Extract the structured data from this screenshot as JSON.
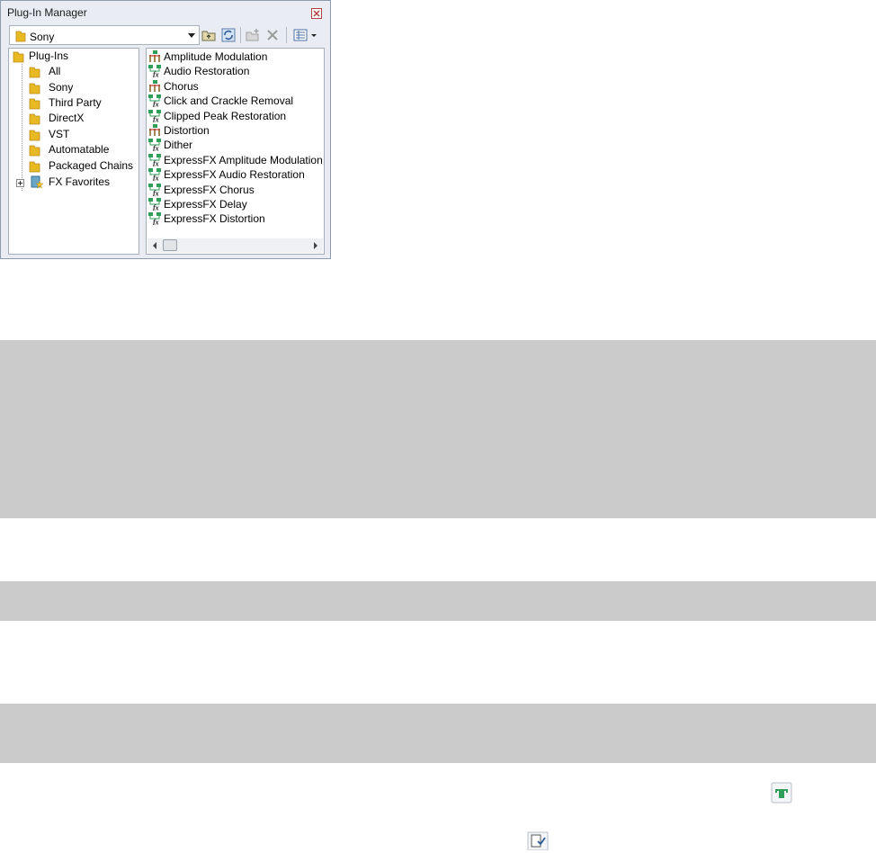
{
  "window": {
    "title": "Plug-In Manager",
    "close_icon": "close-icon"
  },
  "toolbar": {
    "location_value": "Sony",
    "buttons": [
      "folder-up-icon",
      "refresh-icon",
      "new-folder-icon",
      "delete-icon",
      "view-icon"
    ]
  },
  "tree": {
    "root": "Plug-Ins",
    "children": [
      "All",
      "Sony",
      "Third Party",
      "DirectX",
      "VST",
      "Automatable",
      "Packaged Chains"
    ],
    "favorites": "FX Favorites"
  },
  "list": {
    "items": [
      {
        "label": "Amplitude Modulation",
        "kind": "plugin"
      },
      {
        "label": "Audio Restoration",
        "kind": "express"
      },
      {
        "label": "Chorus",
        "kind": "plugin"
      },
      {
        "label": "Click and Crackle Removal",
        "kind": "express"
      },
      {
        "label": "Clipped Peak Restoration",
        "kind": "express"
      },
      {
        "label": "Distortion",
        "kind": "plugin"
      },
      {
        "label": "Dither",
        "kind": "express"
      },
      {
        "label": "ExpressFX Amplitude Modulation",
        "kind": "express"
      },
      {
        "label": "ExpressFX Audio Restoration",
        "kind": "express"
      },
      {
        "label": "ExpressFX Chorus",
        "kind": "express"
      },
      {
        "label": "ExpressFX Delay",
        "kind": "express"
      },
      {
        "label": "ExpressFX Distortion",
        "kind": "express"
      }
    ]
  },
  "colors": {
    "band": "#cbcbcb",
    "folder": "#e8b923",
    "plugin_green": "#2e9e58"
  }
}
